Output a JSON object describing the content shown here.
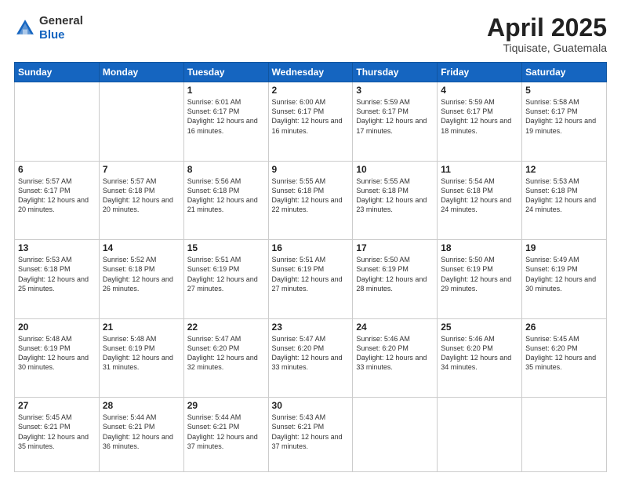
{
  "header": {
    "logo_line1": "General",
    "logo_line2": "Blue",
    "month": "April 2025",
    "location": "Tiquisate, Guatemala"
  },
  "weekdays": [
    "Sunday",
    "Monday",
    "Tuesday",
    "Wednesday",
    "Thursday",
    "Friday",
    "Saturday"
  ],
  "weeks": [
    [
      {
        "day": "",
        "sunrise": "",
        "sunset": "",
        "daylight": "",
        "empty": true
      },
      {
        "day": "",
        "sunrise": "",
        "sunset": "",
        "daylight": "",
        "empty": true
      },
      {
        "day": "1",
        "sunrise": "Sunrise: 6:01 AM",
        "sunset": "Sunset: 6:17 PM",
        "daylight": "Daylight: 12 hours and 16 minutes."
      },
      {
        "day": "2",
        "sunrise": "Sunrise: 6:00 AM",
        "sunset": "Sunset: 6:17 PM",
        "daylight": "Daylight: 12 hours and 16 minutes."
      },
      {
        "day": "3",
        "sunrise": "Sunrise: 5:59 AM",
        "sunset": "Sunset: 6:17 PM",
        "daylight": "Daylight: 12 hours and 17 minutes."
      },
      {
        "day": "4",
        "sunrise": "Sunrise: 5:59 AM",
        "sunset": "Sunset: 6:17 PM",
        "daylight": "Daylight: 12 hours and 18 minutes."
      },
      {
        "day": "5",
        "sunrise": "Sunrise: 5:58 AM",
        "sunset": "Sunset: 6:17 PM",
        "daylight": "Daylight: 12 hours and 19 minutes."
      }
    ],
    [
      {
        "day": "6",
        "sunrise": "Sunrise: 5:57 AM",
        "sunset": "Sunset: 6:17 PM",
        "daylight": "Daylight: 12 hours and 20 minutes."
      },
      {
        "day": "7",
        "sunrise": "Sunrise: 5:57 AM",
        "sunset": "Sunset: 6:18 PM",
        "daylight": "Daylight: 12 hours and 20 minutes."
      },
      {
        "day": "8",
        "sunrise": "Sunrise: 5:56 AM",
        "sunset": "Sunset: 6:18 PM",
        "daylight": "Daylight: 12 hours and 21 minutes."
      },
      {
        "day": "9",
        "sunrise": "Sunrise: 5:55 AM",
        "sunset": "Sunset: 6:18 PM",
        "daylight": "Daylight: 12 hours and 22 minutes."
      },
      {
        "day": "10",
        "sunrise": "Sunrise: 5:55 AM",
        "sunset": "Sunset: 6:18 PM",
        "daylight": "Daylight: 12 hours and 23 minutes."
      },
      {
        "day": "11",
        "sunrise": "Sunrise: 5:54 AM",
        "sunset": "Sunset: 6:18 PM",
        "daylight": "Daylight: 12 hours and 24 minutes."
      },
      {
        "day": "12",
        "sunrise": "Sunrise: 5:53 AM",
        "sunset": "Sunset: 6:18 PM",
        "daylight": "Daylight: 12 hours and 24 minutes."
      }
    ],
    [
      {
        "day": "13",
        "sunrise": "Sunrise: 5:53 AM",
        "sunset": "Sunset: 6:18 PM",
        "daylight": "Daylight: 12 hours and 25 minutes."
      },
      {
        "day": "14",
        "sunrise": "Sunrise: 5:52 AM",
        "sunset": "Sunset: 6:18 PM",
        "daylight": "Daylight: 12 hours and 26 minutes."
      },
      {
        "day": "15",
        "sunrise": "Sunrise: 5:51 AM",
        "sunset": "Sunset: 6:19 PM",
        "daylight": "Daylight: 12 hours and 27 minutes."
      },
      {
        "day": "16",
        "sunrise": "Sunrise: 5:51 AM",
        "sunset": "Sunset: 6:19 PM",
        "daylight": "Daylight: 12 hours and 27 minutes."
      },
      {
        "day": "17",
        "sunrise": "Sunrise: 5:50 AM",
        "sunset": "Sunset: 6:19 PM",
        "daylight": "Daylight: 12 hours and 28 minutes."
      },
      {
        "day": "18",
        "sunrise": "Sunrise: 5:50 AM",
        "sunset": "Sunset: 6:19 PM",
        "daylight": "Daylight: 12 hours and 29 minutes."
      },
      {
        "day": "19",
        "sunrise": "Sunrise: 5:49 AM",
        "sunset": "Sunset: 6:19 PM",
        "daylight": "Daylight: 12 hours and 30 minutes."
      }
    ],
    [
      {
        "day": "20",
        "sunrise": "Sunrise: 5:48 AM",
        "sunset": "Sunset: 6:19 PM",
        "daylight": "Daylight: 12 hours and 30 minutes."
      },
      {
        "day": "21",
        "sunrise": "Sunrise: 5:48 AM",
        "sunset": "Sunset: 6:19 PM",
        "daylight": "Daylight: 12 hours and 31 minutes."
      },
      {
        "day": "22",
        "sunrise": "Sunrise: 5:47 AM",
        "sunset": "Sunset: 6:20 PM",
        "daylight": "Daylight: 12 hours and 32 minutes."
      },
      {
        "day": "23",
        "sunrise": "Sunrise: 5:47 AM",
        "sunset": "Sunset: 6:20 PM",
        "daylight": "Daylight: 12 hours and 33 minutes."
      },
      {
        "day": "24",
        "sunrise": "Sunrise: 5:46 AM",
        "sunset": "Sunset: 6:20 PM",
        "daylight": "Daylight: 12 hours and 33 minutes."
      },
      {
        "day": "25",
        "sunrise": "Sunrise: 5:46 AM",
        "sunset": "Sunset: 6:20 PM",
        "daylight": "Daylight: 12 hours and 34 minutes."
      },
      {
        "day": "26",
        "sunrise": "Sunrise: 5:45 AM",
        "sunset": "Sunset: 6:20 PM",
        "daylight": "Daylight: 12 hours and 35 minutes."
      }
    ],
    [
      {
        "day": "27",
        "sunrise": "Sunrise: 5:45 AM",
        "sunset": "Sunset: 6:21 PM",
        "daylight": "Daylight: 12 hours and 35 minutes."
      },
      {
        "day": "28",
        "sunrise": "Sunrise: 5:44 AM",
        "sunset": "Sunset: 6:21 PM",
        "daylight": "Daylight: 12 hours and 36 minutes."
      },
      {
        "day": "29",
        "sunrise": "Sunrise: 5:44 AM",
        "sunset": "Sunset: 6:21 PM",
        "daylight": "Daylight: 12 hours and 37 minutes."
      },
      {
        "day": "30",
        "sunrise": "Sunrise: 5:43 AM",
        "sunset": "Sunset: 6:21 PM",
        "daylight": "Daylight: 12 hours and 37 minutes."
      },
      {
        "day": "",
        "sunrise": "",
        "sunset": "",
        "daylight": "",
        "empty": true
      },
      {
        "day": "",
        "sunrise": "",
        "sunset": "",
        "daylight": "",
        "empty": true
      },
      {
        "day": "",
        "sunrise": "",
        "sunset": "",
        "daylight": "",
        "empty": true
      }
    ]
  ]
}
